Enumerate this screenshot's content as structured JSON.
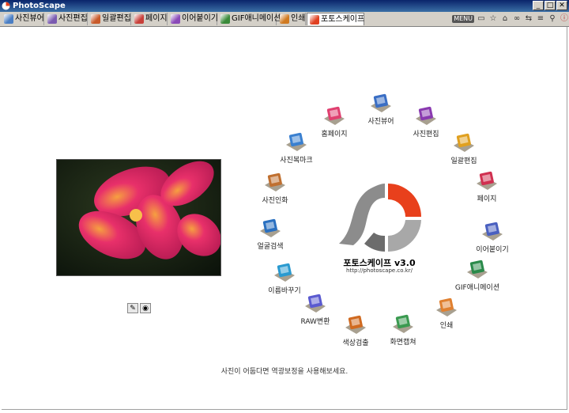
{
  "window": {
    "title": "PhotoScape"
  },
  "tabs": [
    {
      "label": "사진뷰어",
      "color": "#4a7ec4"
    },
    {
      "label": "사진편집",
      "color": "#7a5ab0"
    },
    {
      "label": "일괄편집",
      "color": "#c85a2a"
    },
    {
      "label": "페이지",
      "color": "#c8403a"
    },
    {
      "label": "이어붙이기",
      "color": "#8a4ab8"
    },
    {
      "label": "GIF애니메이션",
      "color": "#3a8a3a"
    },
    {
      "label": "인쇄",
      "color": "#d07a20"
    },
    {
      "label": "포토스케이프",
      "color": "#e04020"
    }
  ],
  "toolbar": {
    "menu_label": "MENU"
  },
  "menu_items": [
    {
      "label": "사진뷰어",
      "color": "#3a6ec4"
    },
    {
      "label": "사진편집",
      "color": "#8a3ab0"
    },
    {
      "label": "일괄편집",
      "color": "#e0a020"
    },
    {
      "label": "페이지",
      "color": "#d03050"
    },
    {
      "label": "이어붙이기",
      "color": "#4a60c0"
    },
    {
      "label": "GIF애니메이션",
      "color": "#2a8a4a"
    },
    {
      "label": "인쇄",
      "color": "#e08030"
    },
    {
      "label": "화면캡쳐",
      "color": "#3a9a50"
    },
    {
      "label": "색상검출",
      "color": "#d06a20"
    },
    {
      "label": "RAW변환",
      "color": "#5a5ad0"
    },
    {
      "label": "이름바꾸기",
      "color": "#2a9ad0"
    },
    {
      "label": "얼굴검색",
      "color": "#2a70c0"
    },
    {
      "label": "사진인화",
      "color": "#c07030"
    },
    {
      "label": "사진복마크",
      "color": "#3a80d0"
    },
    {
      "label": "홈페이지",
      "color": "#e04070"
    }
  ],
  "brand": {
    "name": "포토스케이프 v3.0",
    "url": "http://photoscape.co.kr/"
  },
  "hint": "사진이 어둡다면 역광보정을 사용해보세요.",
  "colors": {
    "accent_red": "#e8401c",
    "logo_gray": "#8c8c8c"
  }
}
